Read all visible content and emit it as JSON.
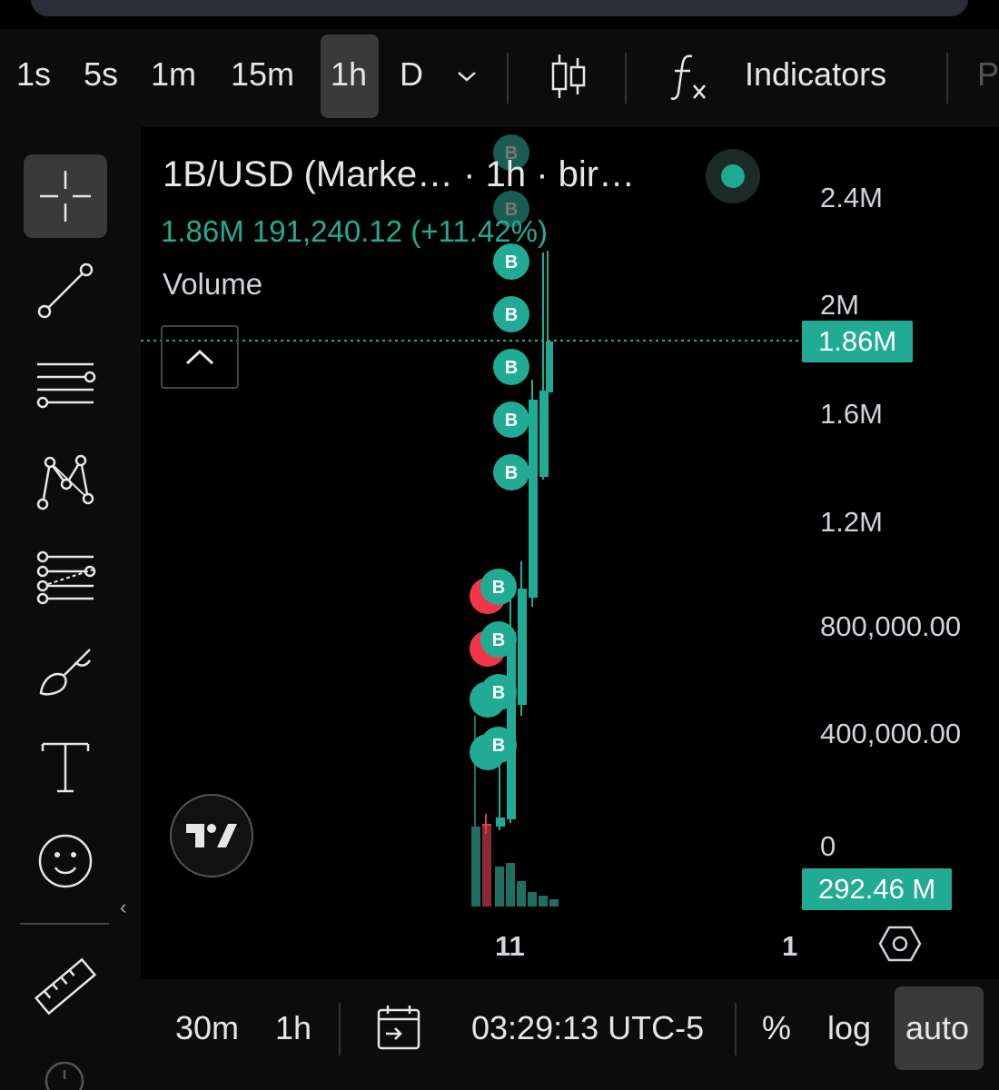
{
  "toolbar": {
    "timeframes": [
      "1s",
      "5s",
      "1m",
      "15m",
      "1h",
      "D"
    ],
    "active_timeframe": "1h",
    "indicators_label": "Indicators",
    "cut_label": "P"
  },
  "sidebar": {
    "tools": [
      "crosshair",
      "trend-line",
      "horizontal-lines",
      "patterns",
      "fib-retracement",
      "brush",
      "text",
      "emoji",
      "ruler"
    ],
    "active_tool": "crosshair"
  },
  "chart": {
    "symbol_title": "1B/USD (Marke…  · 1h · bir…",
    "ohlc_line": "1.86M  191,240.12 (+11.42%)",
    "study_name": "Volume",
    "price_axis": [
      "2.4M",
      "2M",
      "1.6M",
      "1.2M",
      "800,000.00",
      "400,000.00",
      "0"
    ],
    "current_price_badge": "1.86M",
    "volume_badge": "292.46 M",
    "time_axis": [
      "11",
      "1"
    ],
    "marker_letter": "B",
    "colors": {
      "up": "#22ab94",
      "down": "#f23645",
      "bg": "#000000"
    }
  },
  "bottom": {
    "ranges": [
      "30m",
      "1h"
    ],
    "clock": "03:29:13 UTC-5",
    "percent_label": "%",
    "log_label": "log",
    "auto_label": "auto"
  }
}
